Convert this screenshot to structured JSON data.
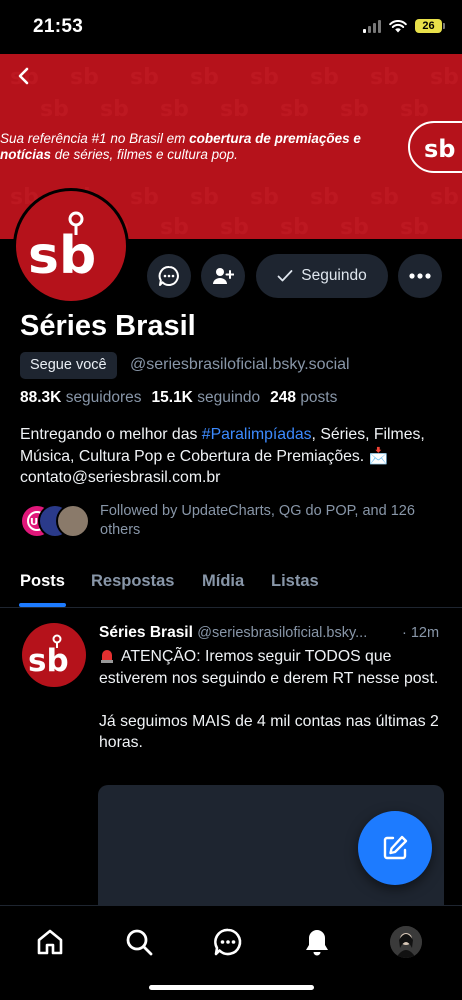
{
  "status_bar": {
    "time": "21:53",
    "battery": "26"
  },
  "banner": {
    "tagline_prefix": "Sua referência #1 no Brasil em ",
    "tagline_bold1": "cobertura de premiações e notícias",
    "tagline_suffix": " de séries, filmes e cultura pop.",
    "brand_color": "#b5121b"
  },
  "profile": {
    "display_name": "Séries Brasil",
    "follows_you_label": "Segue você",
    "handle": "@seriesbrasiloficial.bsky.social",
    "followers_count": "88.3K",
    "followers_label": "seguidores",
    "following_count": "15.1K",
    "following_label": "seguindo",
    "posts_count": "248",
    "posts_label": "posts",
    "bio_part1": "Entregando o melhor das ",
    "bio_hashtag": "#Paralimpíadas",
    "bio_part2": ", Séries, Filmes, Música, Cultura Pop e Cobertura de Premiações. 📩 contato@seriesbrasil.com.br",
    "followed_by": "Followed by UpdateCharts, QG do POP, and 126 others"
  },
  "actions": {
    "following_label": "Seguindo"
  },
  "tabs": [
    {
      "label": "Posts",
      "active": true
    },
    {
      "label": "Respostas",
      "active": false
    },
    {
      "label": "Mídia",
      "active": false
    },
    {
      "label": "Listas",
      "active": false
    }
  ],
  "post": {
    "author": "Séries Brasil",
    "handle": "@seriesbrasiloficial.bsky...",
    "time": "· 12m",
    "body": "ATENÇÃO: Iremos seguir TODOS que estiverem nos seguindo e derem RT nesse post.\n\nJá seguimos MAIS de 4 mil contas nas últimas 2 horas."
  },
  "colors": {
    "accent": "#1d7bff",
    "muted": "#8896a8",
    "surface": "#1e2530"
  }
}
